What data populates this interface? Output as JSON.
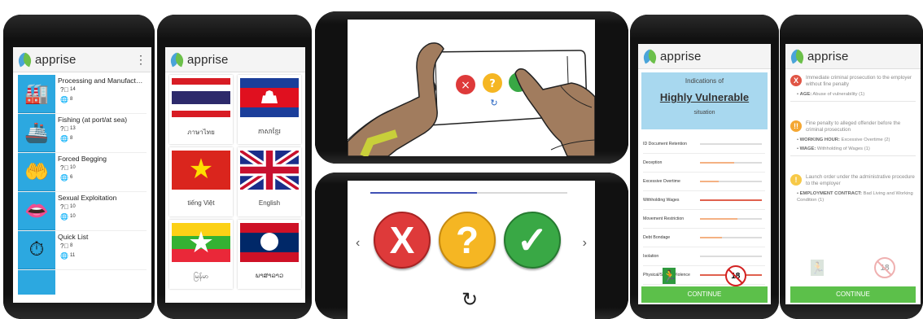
{
  "app": {
    "name": "apprise",
    "menu_icon": "kebab-icon"
  },
  "categories": [
    {
      "title": "Processing and Manufacturi...",
      "questions": "14",
      "languages": "8",
      "icon": "factory-icon"
    },
    {
      "title": "Fishing (at port/at sea)",
      "questions": "13",
      "languages": "8",
      "icon": "ship-icon"
    },
    {
      "title": "Forced Begging",
      "questions": "10",
      "languages": "6",
      "icon": "begging-hand-icon"
    },
    {
      "title": "Sexual Exploitation",
      "questions": "10",
      "languages": "10",
      "icon": "lips-icon"
    },
    {
      "title": "Quick List",
      "questions": "8",
      "languages": "11",
      "icon": "stopwatch-icon"
    }
  ],
  "languages": [
    {
      "name": "ภาษาไทย",
      "flag": "thailand"
    },
    {
      "name": "ភាសាខ្មែរ",
      "flag": "cambodia"
    },
    {
      "name": "tiếng Việt",
      "flag": "vietnam"
    },
    {
      "name": "English",
      "flag": "united-kingdom"
    },
    {
      "name": "မြန်မာ",
      "flag": "myanmar"
    },
    {
      "name": "ພາສາລາວ",
      "flag": "laos"
    }
  ],
  "answers": {
    "no_glyph": "X",
    "maybe_glyph": "?",
    "yes_glyph": "✓",
    "progress_percent": 54,
    "colors": {
      "no": "#de3a3a",
      "maybe": "#f5b623",
      "yes": "#39a845"
    }
  },
  "assessment": {
    "heading_top": "Indications of",
    "level": "Highly Vulnerable",
    "heading_bottom": "situation",
    "indicators": [
      {
        "label": "ID Document Retention",
        "level": 0,
        "color": "#d9d9d9"
      },
      {
        "label": "Deception",
        "level": 0.55,
        "color": "#f4b183"
      },
      {
        "label": "Excessive Overtime",
        "level": 0.3,
        "color": "#f4b183"
      },
      {
        "label": "Withholding Wages",
        "level": 1,
        "color": "#e0604e"
      },
      {
        "label": "Movement Restriction",
        "level": 0.6,
        "color": "#f4b183"
      },
      {
        "label": "Debt Bondage",
        "level": 0.35,
        "color": "#f4b183"
      },
      {
        "label": "Isolation",
        "level": 0,
        "color": "#d9d9d9"
      },
      {
        "label": "Physical/Sexual Violence",
        "level": 1,
        "color": "#e0604e"
      }
    ],
    "symbols": {
      "exit": "exit-sign-icon",
      "age": "18"
    },
    "continue_label": "CONTINUE"
  },
  "actions": {
    "groups": [
      {
        "badge": "X",
        "badge_color": "#e05545",
        "text": "Immediate criminal prosecution to the employer without fine penalty",
        "items": [
          {
            "key": "AGE:",
            "value": " Abuse of vulnerability (1)"
          }
        ]
      },
      {
        "badge": "!!",
        "badge_color": "#f4a733",
        "text": "Fine penalty to alleged offender before the criminal prosecution",
        "items": [
          {
            "key": "WORKING HOUR:",
            "value": " Excessive Overtime (2)"
          },
          {
            "key": "WAGE:",
            "value": " Withholding of Wages (1)"
          }
        ]
      },
      {
        "badge": "!",
        "badge_color": "#f7c948",
        "text": "Launch order under the administrative procedure to the employer",
        "items": [
          {
            "key": "EMPLOYMENT CONTRACT:",
            "value": " Bad Living and Working Condition (1)"
          }
        ]
      }
    ],
    "symbols": {
      "exit": "exit-sign-icon",
      "age": "18"
    },
    "continue_label": "CONTINUE"
  },
  "icons": {
    "questions": "question-circle-icon",
    "languages": "globe-icon",
    "refresh": "refresh-icon"
  }
}
